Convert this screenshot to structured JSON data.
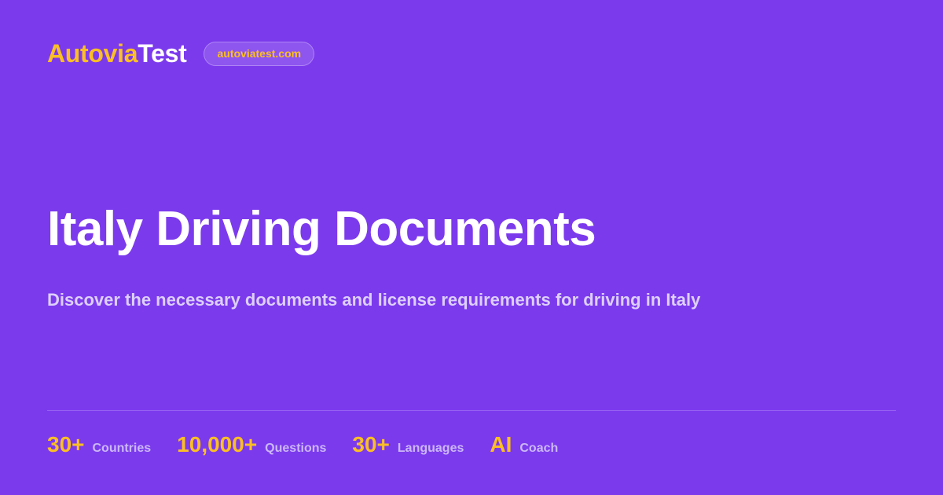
{
  "brand": {
    "name_accent": "Autovia",
    "name_rest": "Test",
    "url": "autoviatest.com"
  },
  "hero": {
    "title": "Italy Driving Documents",
    "subtitle": "Discover the necessary documents and license requirements for driving in Italy"
  },
  "stats": [
    {
      "value": "30+",
      "label": "Countries"
    },
    {
      "value": "10,000+",
      "label": "Questions"
    },
    {
      "value": "30+",
      "label": "Languages"
    },
    {
      "value": "AI",
      "label": "Coach"
    }
  ],
  "colors": {
    "background": "#7c3aed",
    "accent": "#fbbf24",
    "text": "#ffffff"
  }
}
